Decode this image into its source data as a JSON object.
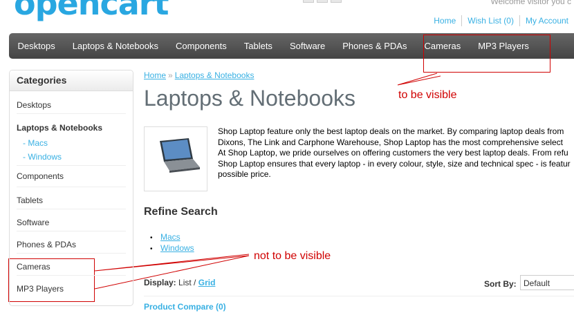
{
  "header": {
    "logo": "opencart",
    "welcome": "Welcome visitor you c",
    "links": [
      "Home",
      "Wish List (0)",
      "My Account"
    ]
  },
  "menu": [
    "Desktops",
    "Laptops & Notebooks",
    "Components",
    "Tablets",
    "Software",
    "Phones & PDAs",
    "Cameras",
    "MP3 Players"
  ],
  "annotations": {
    "visible": "to be visible",
    "not_visible": "not to be visible",
    "color": "#d00000"
  },
  "sidebar": {
    "heading": "Categories",
    "items": [
      {
        "label": "Desktops"
      },
      {
        "label": "Laptops & Notebooks"
      },
      {
        "label": "Components"
      },
      {
        "label": "Tablets"
      },
      {
        "label": "Software"
      },
      {
        "label": "Phones & PDAs"
      },
      {
        "label": "Cameras"
      },
      {
        "label": "MP3 Players"
      }
    ],
    "subitems": [
      "- Macs",
      "- Windows"
    ]
  },
  "breadcrumb": {
    "home": "Home",
    "sep": "»",
    "current": "Laptops & Notebooks"
  },
  "page_title": "Laptops & Notebooks",
  "description": [
    "Shop Laptop feature only the best laptop deals on the market. By comparing laptop deals from",
    "Dixons, The Link and Carphone Warehouse, Shop Laptop has the most comprehensive select",
    "At Shop Laptop, we pride ourselves on offering customers the very best laptop deals. From refu",
    "Shop Laptop ensures that every laptop - in every colour, style, size and technical spec - is featur",
    "possible price."
  ],
  "refine": {
    "heading": "Refine Search",
    "items": [
      "Macs",
      "Windows"
    ]
  },
  "display": {
    "label": "Display:",
    "list": "List",
    "slash": " / ",
    "grid": "Grid"
  },
  "sort": {
    "label": "Sort By:",
    "value": "Default"
  },
  "compare": "Product Compare (0)",
  "colors": {
    "link": "#38B0E3",
    "menu_bg": "#555555",
    "logo": "#29a7e1"
  }
}
